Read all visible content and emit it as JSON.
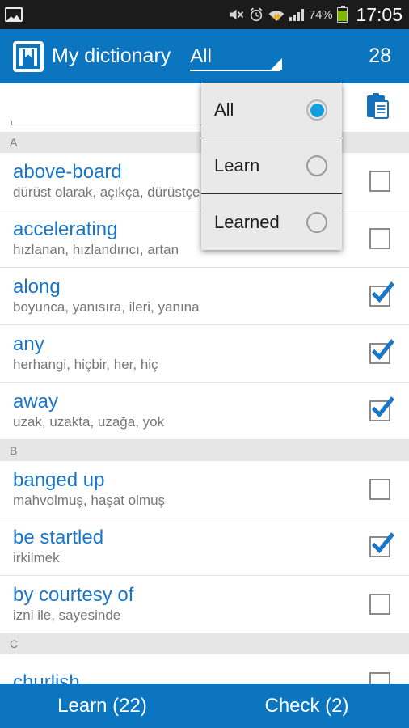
{
  "statusbar": {
    "gallery_icon": "gallery-icon",
    "mute_icon": "mute-icon",
    "alarm_icon": "alarm-icon",
    "wifi_icon": "wifi-transfer-icon",
    "signal_icon": "signal-bars-icon",
    "battery_percent": "74%",
    "battery_icon": "battery-icon",
    "time": "17:05"
  },
  "appbar": {
    "app_icon": "dictionary-book-icon",
    "title": "My dictionary",
    "spinner_value": "All",
    "caret_icon": "dropdown-caret-icon",
    "count": "28"
  },
  "search": {
    "value": "",
    "placeholder": "",
    "clipboard_icon": "clipboard-icon"
  },
  "dropdown": {
    "open": true,
    "items": [
      {
        "label": "All",
        "selected": true
      },
      {
        "label": "Learn",
        "selected": false
      },
      {
        "label": "Learned",
        "selected": false
      }
    ]
  },
  "list": {
    "sections": [
      {
        "header": "A",
        "rows": [
          {
            "word": "above-board",
            "translation": "dürüst olarak, açıkça, dürüstçe",
            "checked": false
          },
          {
            "word": "accelerating",
            "translation": "hızlanan, hızlandırıcı, artan",
            "checked": false
          },
          {
            "word": "along",
            "translation": "boyunca, yanısıra, ileri, yanına",
            "checked": true
          },
          {
            "word": "any",
            "translation": "herhangi, hiçbir, her, hiç",
            "checked": true
          },
          {
            "word": "away",
            "translation": "uzak, uzakta, uzağa, yok",
            "checked": true
          }
        ]
      },
      {
        "header": "B",
        "rows": [
          {
            "word": "banged up",
            "translation": "mahvolmuş, haşat olmuş",
            "checked": false
          },
          {
            "word": "be startled",
            "translation": "irkilmek",
            "checked": true
          },
          {
            "word": "by courtesy of",
            "translation": "izni ile, sayesinde",
            "checked": false
          }
        ]
      },
      {
        "header": "C",
        "rows": [
          {
            "word": "churlish",
            "translation": "",
            "checked": false
          }
        ]
      }
    ]
  },
  "bottombar": {
    "learn_label": "Learn (22)",
    "check_label": "Check (2)"
  },
  "colors": {
    "accent": "#0b76bf",
    "word": "#1a76c8",
    "statusbar": "#1b1b1b",
    "section_header": "#e6e6e6",
    "battery_fill": "#7fb800"
  }
}
